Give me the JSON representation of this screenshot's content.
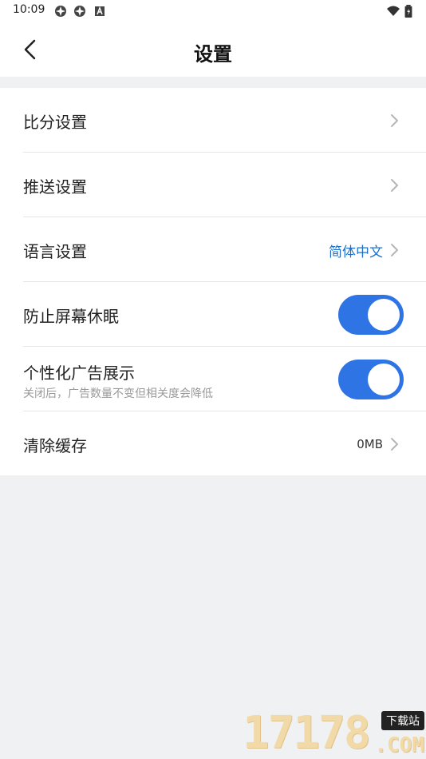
{
  "status_bar": {
    "time": "10:09",
    "icons": [
      "app-notification-icon",
      "app-notification-icon",
      "a-box-icon",
      "wifi-icon",
      "battery-icon"
    ]
  },
  "header": {
    "title": "设置",
    "back_icon": "chevron-left-icon"
  },
  "settings": {
    "score": {
      "label": "比分设置"
    },
    "push": {
      "label": "推送设置"
    },
    "language": {
      "label": "语言设置",
      "value": "简体中文"
    },
    "keep_screen_on": {
      "label": "防止屏幕休眠",
      "enabled": true
    },
    "personalized_ads": {
      "label": "个性化广告展示",
      "description": "关闭后，广告数量不变但相关度会降低",
      "enabled": true
    },
    "clear_cache": {
      "label": "清除缓存",
      "value": "0MB"
    }
  },
  "colors": {
    "toggle_on": "#2f74e4",
    "link_blue": "#1f6fc9",
    "background": "#f0f1f3"
  },
  "watermark": {
    "digits": "17178",
    "badge": "下载站",
    "suffix": ".COM"
  }
}
